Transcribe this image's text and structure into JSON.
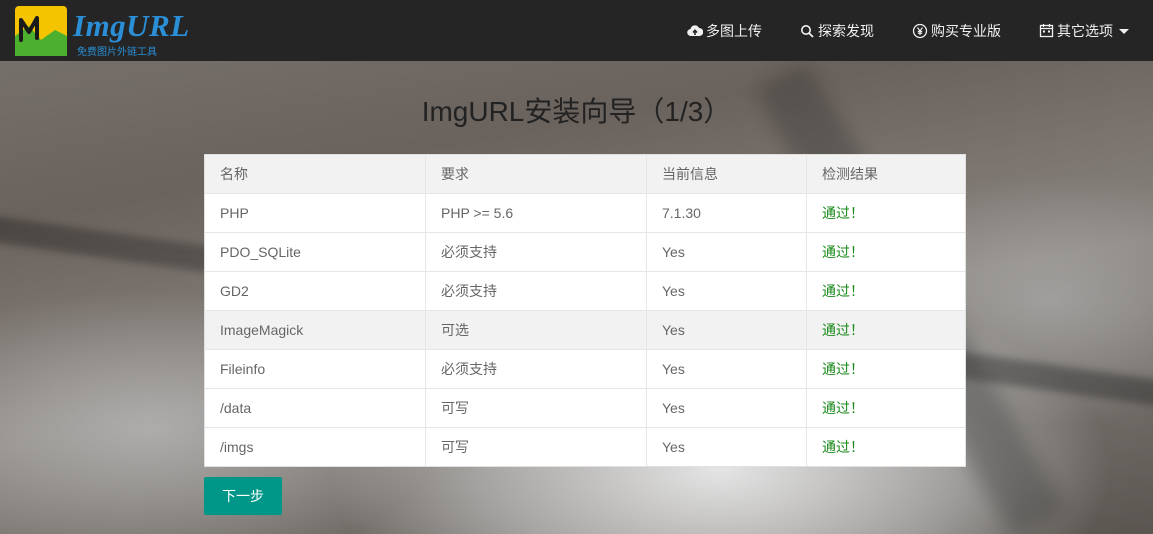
{
  "navbar": {
    "logo_title": "ImgURL",
    "logo_subtitle": "免费图片外链工具",
    "items": [
      {
        "label": "多图上传",
        "icon": "cloud-upload-icon"
      },
      {
        "label": "探索发现",
        "icon": "search-icon"
      },
      {
        "label": "购买专业版",
        "icon": "yen-icon"
      },
      {
        "label": "其它选项",
        "icon": "calendar-icon"
      }
    ]
  },
  "page": {
    "title": "ImgURL安装向导（1/3）"
  },
  "table": {
    "headers": [
      "名称",
      "要求",
      "当前信息",
      "检测结果"
    ],
    "rows": [
      [
        "PHP",
        "PHP >= 5.6",
        "7.1.30",
        "通过！"
      ],
      [
        "PDO_SQLite",
        "必须支持",
        "Yes",
        "通过！"
      ],
      [
        "GD2",
        "必须支持",
        "Yes",
        "通过！"
      ],
      [
        "ImageMagick",
        "可选",
        "Yes",
        "通过！"
      ],
      [
        "Fileinfo",
        "必须支持",
        "Yes",
        "通过！"
      ],
      [
        "/data",
        "可写",
        "Yes",
        "通过！"
      ],
      [
        "/imgs",
        "可写",
        "Yes",
        "通过！"
      ]
    ]
  },
  "actions": {
    "next_label": "下一步"
  },
  "colors": {
    "navbar_bg": "#252525",
    "accent": "#009688",
    "pass": "#1a8a1a",
    "logo_blue": "#2a8fd6"
  }
}
